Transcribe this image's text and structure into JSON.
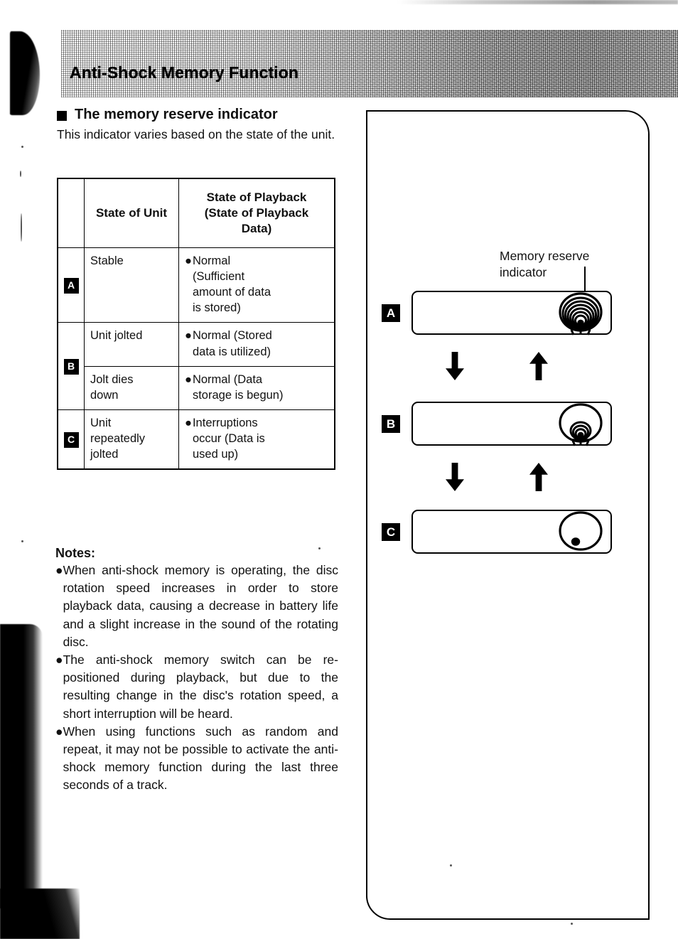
{
  "page": {
    "title": "Anti-Shock Memory Function"
  },
  "section": {
    "heading": "The memory reserve indicator",
    "intro": "This indicator varies based on the state of the unit."
  },
  "table": {
    "headers": {
      "badge": "",
      "unit": "State of Unit",
      "playback": "State of Playback (State of Playback Data)"
    },
    "header_playback_lines": [
      "State of Playback",
      "(State of Playback",
      "Data)"
    ],
    "rows": [
      {
        "badge": "A",
        "unit": "Stable",
        "bullet": "●",
        "playback": "Normal (Sufficient amount of data is stored)",
        "playback_lines": [
          "Normal",
          "(Sufficient",
          "amount of data",
          "is stored)"
        ]
      },
      {
        "badge": "B",
        "unit": "Unit jolted",
        "bullet": "●",
        "playback": "Normal (Stored data is utilized)",
        "playback_lines": [
          "Normal (Stored",
          "data is utilized)"
        ]
      },
      {
        "badge": "",
        "unit": "Jolt dies down",
        "bullet": "●",
        "playback": "Normal (Data storage is begun)",
        "playback_lines": [
          "Normal (Data",
          "storage is begun)"
        ]
      },
      {
        "badge": "C",
        "unit": "Unit repeatedly jolted",
        "bullet": "●",
        "playback": "Interruptions occur (Data is used up)",
        "playback_lines": [
          "Interruptions",
          "occur (Data is",
          "used up)"
        ]
      }
    ]
  },
  "notes": {
    "title": "Notes:",
    "bullet": "●",
    "items": [
      "When anti-shock memory is operating, the disc rotation speed increases in order to store playback data, causing a decrease in battery life and a slight increase in the sound of the rotating disc.",
      "The anti-shock memory switch can be re-positioned during playback, but due to the resulting change in the disc's rotation speed, a short interruption will be heard.",
      "When using functions such as random and repeat, it may not be possible to activate the anti-shock memory function during the last three seconds of a track."
    ]
  },
  "diagram": {
    "callout_label": "Memory reserve indicator",
    "callout_label_lines": [
      "Memory reserve",
      "indicator"
    ],
    "states": [
      {
        "badge": "A",
        "indicator": "full-rings-icon",
        "description": "Memory reserve indicator full – many concentric arcs"
      },
      {
        "badge": "B",
        "indicator": "partial-rings-icon",
        "description": "Memory reserve indicator partial – few small arcs"
      },
      {
        "badge": "C",
        "indicator": "empty-dot-icon",
        "description": "Memory reserve indicator empty – single dot"
      }
    ],
    "arrows": [
      {
        "down": "down-arrow-icon",
        "up": "up-arrow-icon"
      },
      {
        "down": "down-arrow-icon",
        "up": "up-arrow-icon"
      }
    ]
  },
  "colors": {
    "ink": "#111111",
    "badge_bg": "#000000",
    "badge_fg": "#ffffff",
    "band_light": "#fdfdfd",
    "band_dark": "#b2b2b2"
  }
}
